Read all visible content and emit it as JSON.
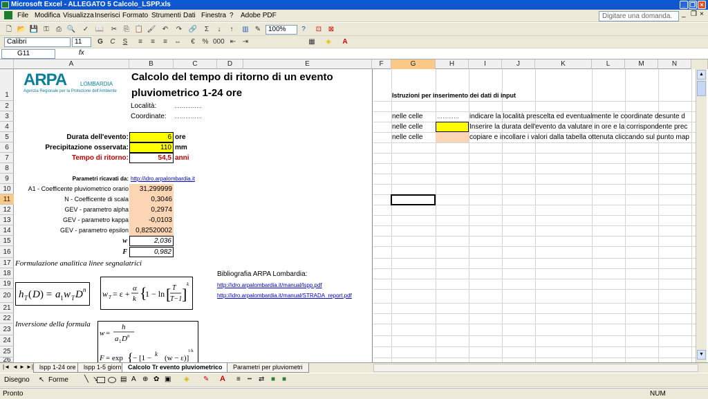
{
  "window": {
    "title": "Microsoft Excel - ALLEGATO 5 Calcolo_LSPP.xls"
  },
  "menu": {
    "items": [
      "File",
      "Modifica",
      "Visualizza",
      "Inserisci",
      "Formato",
      "Strumenti",
      "Dati",
      "Finestra",
      "?",
      "Adobe PDF"
    ],
    "ask_placeholder": "Digitare una domanda."
  },
  "toolbar": {
    "zoom": "100%",
    "font": "Calibri",
    "size": "11"
  },
  "formula_bar": {
    "namebox": "G11",
    "fx": "fx",
    "value": ""
  },
  "columns": [
    "A",
    "B",
    "C",
    "D",
    "E",
    "F",
    "G",
    "H",
    "I",
    "J",
    "K",
    "L",
    "M",
    "N"
  ],
  "rows": [
    "1",
    "2",
    "3",
    "4",
    "5",
    "6",
    "7",
    "8",
    "9",
    "10",
    "11",
    "12",
    "13",
    "14",
    "15",
    "16",
    "17",
    "18",
    "19",
    "20",
    "21",
    "22",
    "23",
    "24",
    "25",
    "26"
  ],
  "sheet": {
    "logo": {
      "brand": "ARPA",
      "region": "LOMBARDIA",
      "tagline": "Agenzia Regionale per la Protezione dell'Ambiente"
    },
    "title_line1": "Calcolo del tempo di ritorno di un evento",
    "title_line2": "pluviometrico 1-24 ore",
    "localita_label": "Località:",
    "localita_value": "……………",
    "coordinate_label": "Coordinate:",
    "coordinate_value": "……………",
    "durata_label": "Durata dell'evento:",
    "durata_value": "6",
    "durata_unit": "ore",
    "precip_label": "Precipitazione osservata:",
    "precip_value": "110",
    "precip_unit": "mm",
    "tr_label": "Tempo di ritorno:",
    "tr_value": "54,5",
    "tr_unit": "anni",
    "params_label": "Parametri ricavati da:",
    "params_link": "http://idro.arpalombardia.it",
    "params": [
      {
        "label": "A1 - Coefficente pluviometrico orario",
        "value": "31,299999"
      },
      {
        "label": "N - Coefficente di scala",
        "value": "0,3046"
      },
      {
        "label": "GEV - parametro alpha",
        "value": "0,2974"
      },
      {
        "label": "GEV - parametro kappa",
        "value": "-0,0103"
      },
      {
        "label": "GEV - parametro epsilon",
        "value": "0,82520002"
      }
    ],
    "w_label": "w",
    "w_value": "2,036",
    "f_label": "F",
    "f_value": "0,982",
    "formulazione": "Formulazione analitica linee segnalatrici",
    "inversione": "Inversione della formula",
    "biblio_title": "Bibliografia ARPA Lombardia:",
    "biblio_links": [
      "http://idro.arpalombardia.it/manual/lspp.pdf",
      "http://idro.arpalombardia.it/manual/STRADA_report.pdf"
    ],
    "istruzioni_title": "Istruzioni per inserimento dei dati di input",
    "istruzioni": [
      {
        "prefix": "nelle celle",
        "marker": "…………",
        "text": "indicare la località prescelta ed eventualmente le coordinate desunte d"
      },
      {
        "prefix": "nelle celle",
        "marker": "",
        "text": "Inserire la durata dell'evento da valutare in ore e la corrispondente prec"
      },
      {
        "prefix": "nelle celle",
        "marker": "",
        "text": "copiare e incollare i valori dalla tabella ottenuta cliccando sul punto map"
      }
    ]
  },
  "sheet_tabs": [
    "lspp 1-24 ore",
    "lspp 1-5 giorni",
    "Calcolo Tr evento pluviometrico",
    "Parametri per pluviometri"
  ],
  "drawbar": {
    "disegno": "Disegno",
    "forme": "Forme"
  },
  "status": {
    "left": "Pronto",
    "num": "NUM"
  },
  "colors": {
    "title_bar": "#0a58d8",
    "yellow_cell": "#ffff00",
    "orange_cell": "#fcd5b4",
    "accent_red": "#c00000"
  }
}
